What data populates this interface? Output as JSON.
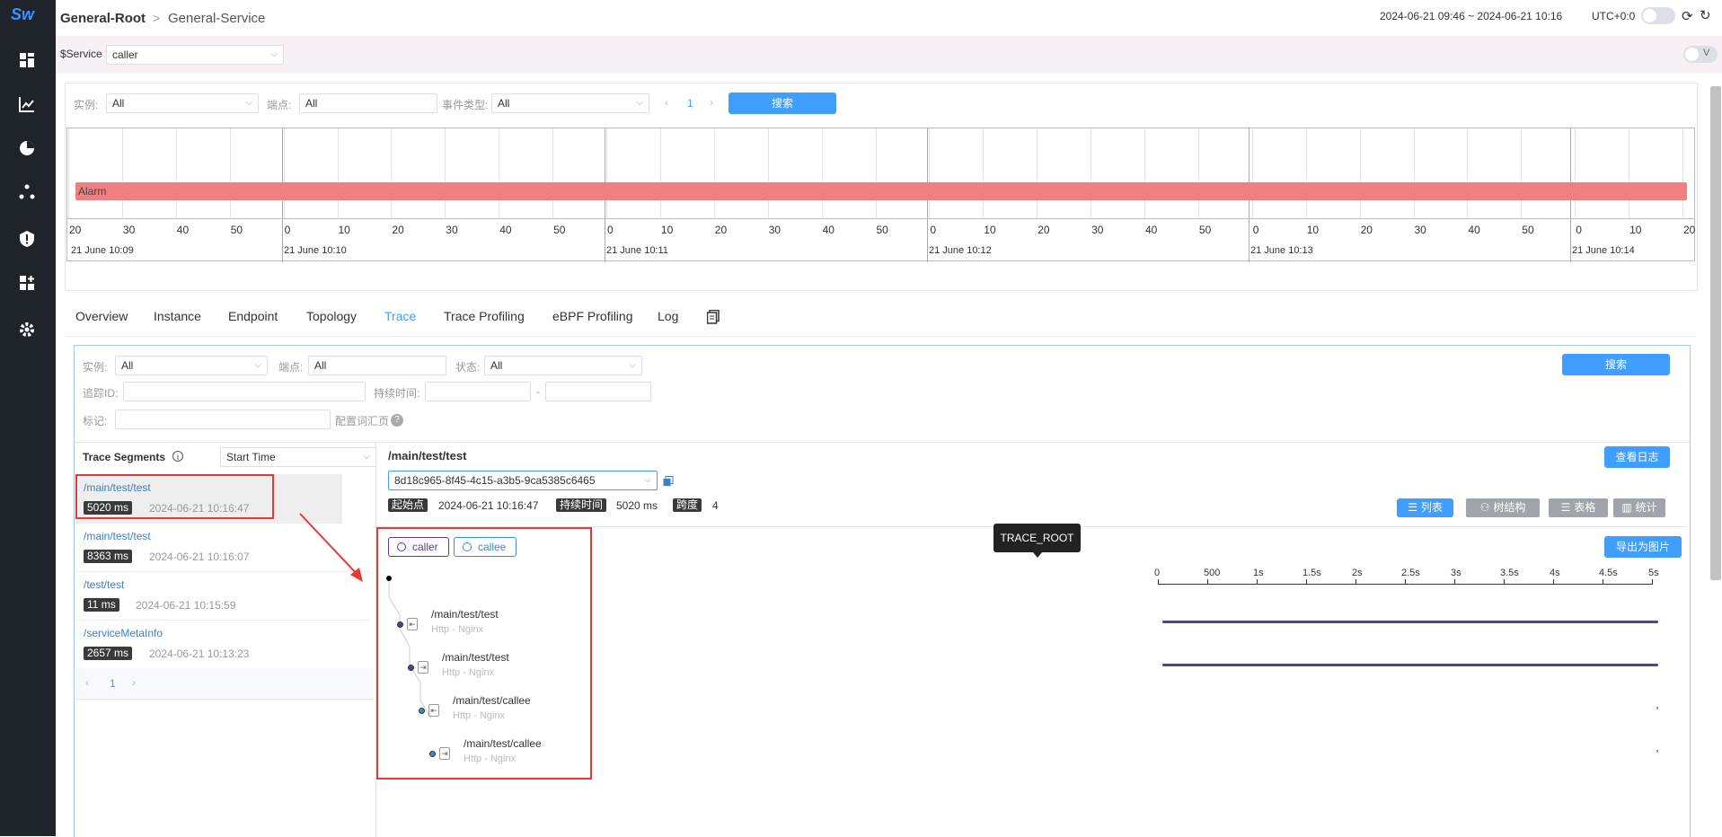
{
  "header": {
    "crumb_root": "General-Root",
    "crumb_sep": ">",
    "crumb_service": "General-Service",
    "time_range": "2024-06-21 09:46 ~ 2024-06-21 10:16",
    "timezone": "UTC+0:0"
  },
  "sidebar": {
    "logo": "Sw"
  },
  "vars": {
    "label": "$Service",
    "value": "caller",
    "toggle": "V"
  },
  "event_filter": {
    "instance_label": "实例:",
    "instance_value": "All",
    "endpoint_label": "端点:",
    "endpoint_value": "All",
    "type_label": "事件类型:",
    "type_value": "All",
    "page": "1",
    "search": "搜索"
  },
  "timeline": {
    "alarm_label": "Alarm",
    "ticks": [
      "20",
      "30",
      "40",
      "50",
      "0",
      "10",
      "20",
      "30",
      "40",
      "50",
      "0",
      "10",
      "20",
      "30",
      "40",
      "50",
      "0",
      "10",
      "20",
      "30",
      "40",
      "50",
      "0",
      "10",
      "20",
      "30",
      "40",
      "50",
      "0",
      "10",
      "20"
    ],
    "dates": [
      "21 June 10:09",
      "21 June 10:10",
      "21 June 10:11",
      "21 June 10:12",
      "21 June 10:13",
      "21 June 10:14"
    ]
  },
  "tabs": [
    "Overview",
    "Instance",
    "Endpoint",
    "Topology",
    "Trace",
    "Trace Profiling",
    "eBPF Profiling",
    "Log"
  ],
  "active_tab": "Trace",
  "trace_filter": {
    "instance_label": "实例:",
    "instance_value": "All",
    "endpoint_label": "端点:",
    "endpoint_value": "All",
    "status_label": "状态:",
    "status_value": "All",
    "trace_id_label": "追踪ID:",
    "duration_label": "持续时间:",
    "duration_sep": "-",
    "tags_label": "标记:",
    "tags_help": "配置词汇页",
    "search": "搜索"
  },
  "segments": {
    "title": "Trace Segments",
    "sort_value": "Start Time",
    "items": [
      {
        "name": "/main/test/test",
        "duration": "5020 ms",
        "time": "2024-06-21 10:16:47"
      },
      {
        "name": "/main/test/test",
        "duration": "8363 ms",
        "time": "2024-06-21 10:16:07"
      },
      {
        "name": "/test/test",
        "duration": "11 ms",
        "time": "2024-06-21 10:15:59"
      },
      {
        "name": "/serviceMetaInfo",
        "duration": "2657 ms",
        "time": "2024-06-21 10:13:23"
      }
    ],
    "page": "1"
  },
  "trace_detail": {
    "title": "/main/test/test",
    "view_logs": "查看日志",
    "trace_id": "8d18c965-8f45-4c15-a3b5-9ca5385c6465",
    "start_label": "起始点",
    "start_value": "2024-06-21 10:16:47",
    "duration_label": "持续时间",
    "duration_value": "5020 ms",
    "span_label": "跨度",
    "span_value": "4",
    "views": [
      "列表",
      "树结构",
      "表格",
      "统计"
    ],
    "export": "导出为图片",
    "legend": [
      "caller",
      "callee"
    ],
    "tooltip": "TRACE_ROOT",
    "axis": [
      "0",
      "500",
      "1s",
      "1.5s",
      "2s",
      "2.5s",
      "3s",
      "3.5s",
      "4s",
      "4.5s",
      "5s"
    ],
    "nodes": [
      {
        "name": "/main/test/test",
        "sub": "Http - Nginx"
      },
      {
        "name": "/main/test/test",
        "sub": "Http - Nginx"
      },
      {
        "name": "/main/test/callee",
        "sub": "Http - Nginx"
      },
      {
        "name": "/main/test/callee",
        "sub": "Http - Nginx"
      }
    ]
  },
  "colors": {
    "caller": "#5b3a95",
    "callee": "#3a8ad0",
    "alarm": "#f08080",
    "accent": "#409eff",
    "highlight": "#e53935"
  }
}
